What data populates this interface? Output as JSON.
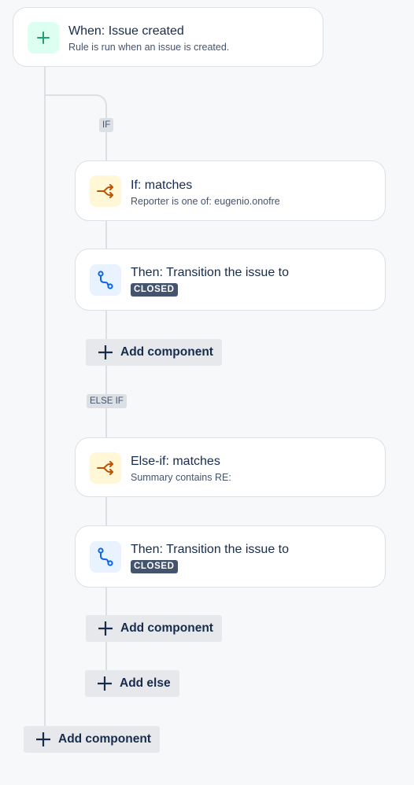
{
  "trigger": {
    "title": "When: Issue created",
    "subtitle": "Rule is run when an issue is created.",
    "icon": "plus-icon"
  },
  "branch_labels": {
    "if": "IF",
    "else_if": "ELSE IF"
  },
  "if_condition": {
    "title": "If: matches",
    "subtitle": "Reporter is one of: eugenio.onofre",
    "icon": "branch-icon"
  },
  "if_action": {
    "title": "Then: Transition the issue to",
    "status": "CLOSED",
    "icon": "transition-icon"
  },
  "if_add_component": "Add component",
  "else_if_condition": {
    "title": "Else-if: matches",
    "subtitle": "Summary contains RE:",
    "icon": "branch-icon"
  },
  "else_if_action": {
    "title": "Then: Transition the issue to",
    "status": "CLOSED",
    "icon": "transition-icon"
  },
  "else_if_add_component": "Add component",
  "add_else": "Add else",
  "root_add_component": "Add component",
  "colors": {
    "connector": "#dcdfe4",
    "status_lozenge": "#44546f",
    "trigger_icon": "#22a06b",
    "condition_icon": "#c25100",
    "action_icon": "#0c66e4"
  }
}
